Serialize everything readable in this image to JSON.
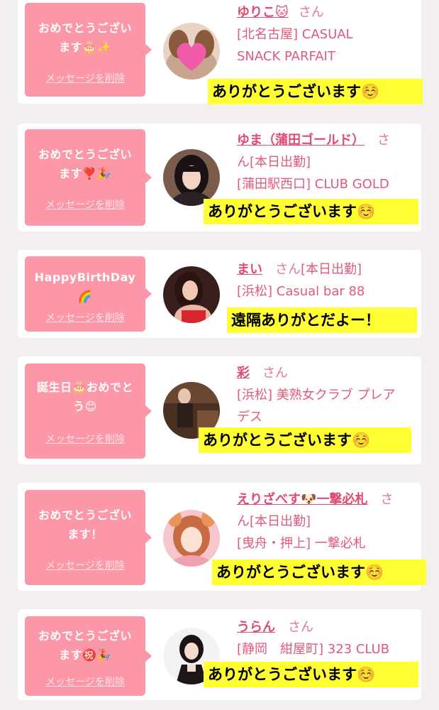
{
  "colors": {
    "background": "#f3eef0",
    "card": "#ffffff",
    "bubble": "#fb97a6",
    "name": "#e04a70",
    "info": "#e05a7a",
    "highlight": "#ffff33"
  },
  "delete_label": "メッセージを削除",
  "san_label": "さん",
  "cards": [
    {
      "message_line1": "おめでとうござい",
      "message_line2": "ます🎂✨",
      "name": "ゆりこ🐱",
      "status": "",
      "info_line1": "[北名古屋] CASUAL",
      "info_line2": "SNACK PARFAIT",
      "reply": "ありがとうございます☺️",
      "avatar_icon": "heart-sticker-photo"
    },
    {
      "message_line1": "おめでとうござい",
      "message_line2": "ます❣️🎉",
      "name": "ゆま（蒲田ゴールド）",
      "status": "[本日出勤]",
      "info_line1": "[蒲田駅西口] CLUB GOLD",
      "info_line2": "",
      "reply": "ありがとうございます☺️",
      "avatar_icon": "woman-photo"
    },
    {
      "message_line1": "HappyBirthDay",
      "message_line2": "🌈",
      "name": "まい",
      "status": "[本日出勤]",
      "info_line1": "[浜松] Casual bar 88",
      "info_line2": "",
      "reply": "遠隔ありがとだよー！",
      "avatar_icon": "woman-photo"
    },
    {
      "message_line1": "誕生日🎂おめでと",
      "message_line2": "う😊",
      "name": "彩",
      "status": "",
      "info_line1": "[浜松] 美熟女クラブ プレア",
      "info_line2": "デス",
      "reply": "ありがとうございます☺️",
      "avatar_icon": "woman-photo"
    },
    {
      "message_line1": "おめでとうござい",
      "message_line2": "ます！",
      "name": "えりざべす🐶一撃必札",
      "status": "[本日出勤]",
      "info_line1": "[曳舟・押上] 一撃必札",
      "info_line2": "",
      "reply": "ありがとうございます☺️",
      "avatar_icon": "woman-photo"
    },
    {
      "message_line1": "おめでとうござい",
      "message_line2": "ます㊗️🎉",
      "name": "うらん",
      "status": "",
      "info_line1": "[静岡　紺屋町] 323 CLUB",
      "info_line2": "",
      "reply": "ありがとうございます☺️",
      "avatar_icon": "woman-photo"
    }
  ]
}
